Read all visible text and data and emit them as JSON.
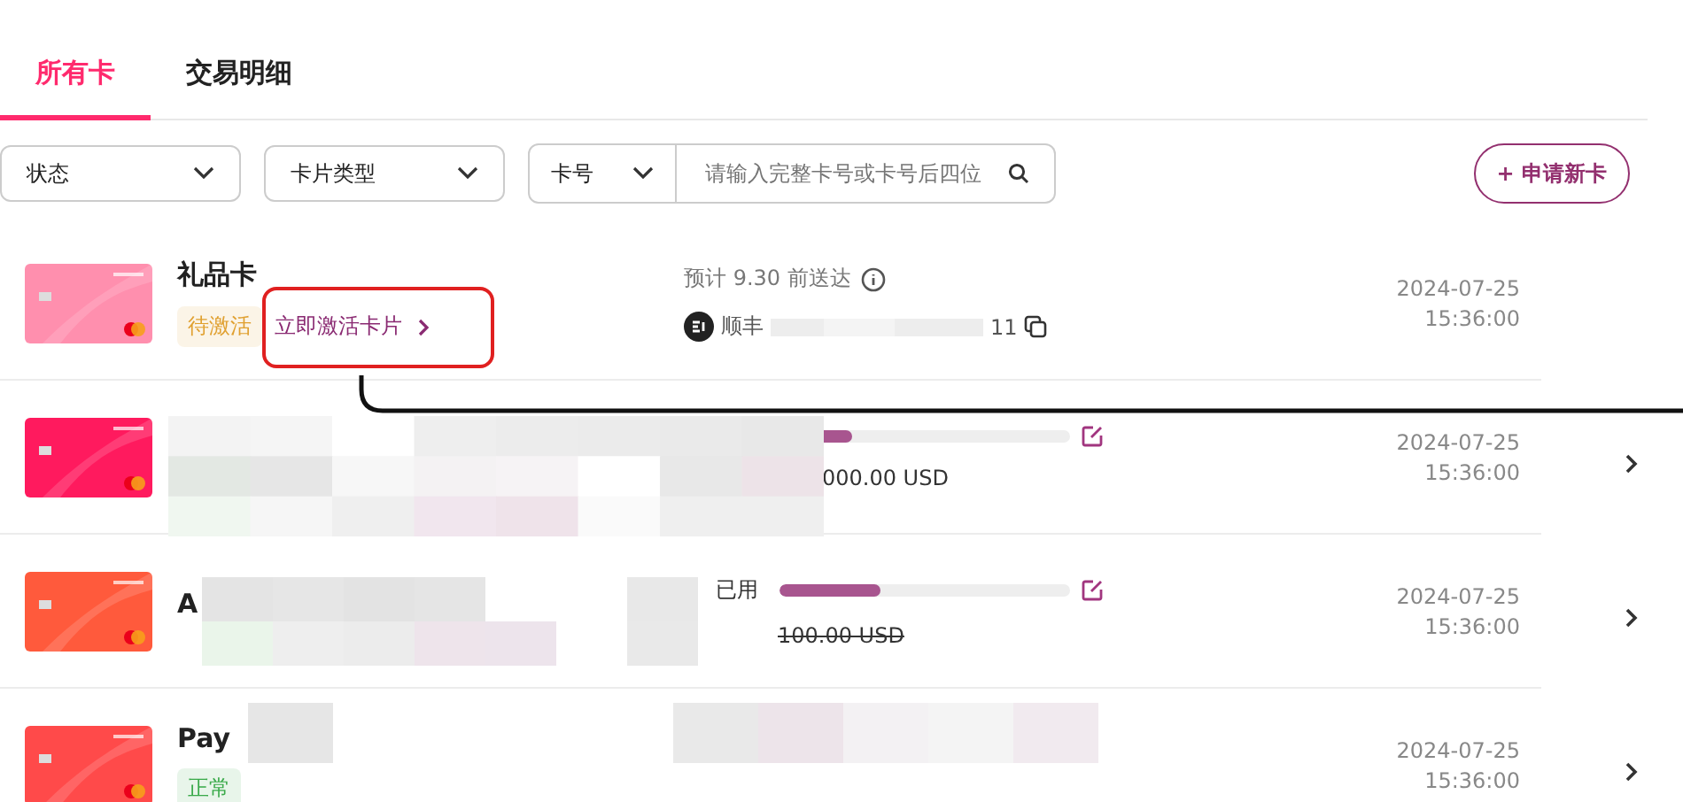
{
  "tabs": [
    {
      "label": "所有卡",
      "selected": true
    },
    {
      "label": "交易明细",
      "selected": false
    }
  ],
  "filters": {
    "status": {
      "placeholder": "状态"
    },
    "card_type": {
      "placeholder": "卡片类型"
    },
    "search_by": "卡号",
    "search": {
      "placeholder": "请输入完整卡号或卡号后四位"
    },
    "apply_button": "+ 申请新卡"
  },
  "rows": [
    {
      "color": "#ff8fae",
      "name": "礼品卡",
      "status": {
        "text": "待激活",
        "color": "#e0a030"
      },
      "action": "立即激活卡片",
      "eta": "预计 9.30 前送达",
      "courier": "顺丰",
      "tracking_tail": "11",
      "date": "2024-07-25",
      "time": "15:36:00",
      "chevron": false
    },
    {
      "color": "#ff1a5e",
      "amount": "000.00 USD",
      "level": 0.25,
      "date": "2024-07-25",
      "time": "15:36:00",
      "chevron": true
    },
    {
      "color": "#ff5a3c",
      "name": "A",
      "used_label": "已用",
      "level": 0.35,
      "amount": "100.00 USD",
      "date": "2024-07-25",
      "time": "15:36:00",
      "chevron": true
    },
    {
      "color": "#ff4a4a",
      "name": "Pay",
      "status": {
        "text": "正常",
        "color": "#3aaa4a"
      },
      "date": "2024-07-25",
      "time": "15:36:00",
      "chevron": true
    }
  ]
}
